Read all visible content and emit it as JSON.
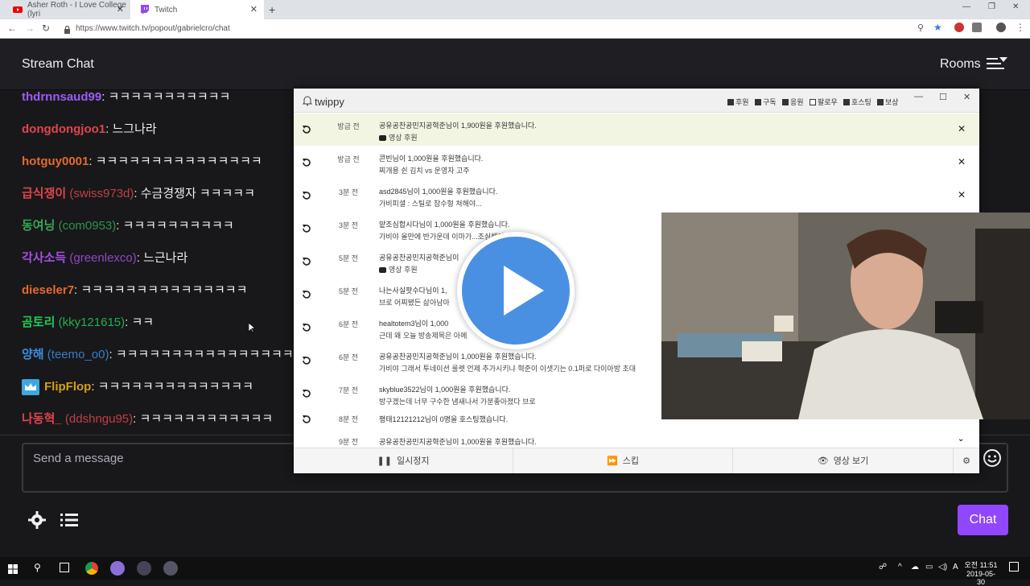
{
  "browser": {
    "tabs": [
      {
        "title": "Asher Roth - I Love College (lyri"
      },
      {
        "title": "Twitch"
      }
    ],
    "url": "https://www.twitch.tv/popout/gabrielcro/chat"
  },
  "header": {
    "title": "Stream Chat",
    "rooms_label": "Rooms"
  },
  "messages": [
    {
      "user": "thdrnnsaud99",
      "login": "",
      "text": ": ㅋㅋㅋㅋㅋㅋㅋㅋㅋㅋㅋ",
      "color": "#9c5bf6"
    },
    {
      "user": "dongdongjoo1",
      "login": "",
      "text": ": 느그나라",
      "color": "#e0454d"
    },
    {
      "user": "hotguy0001",
      "login": "",
      "text": ": ㅋㅋㅋㅋㅋㅋㅋㅋㅋㅋㅋㅋㅋㅋㅋ",
      "color": "#e46a2e"
    },
    {
      "user": "급식쟁이",
      "login": " (swiss973d)",
      "text": ": 수금경쟁자 ㅋㅋㅋㅋㅋ",
      "color": "#e0454d"
    },
    {
      "user": "동여닝",
      "login": " (com0953)",
      "text": ": ㅋㅋㅋㅋㅋㅋㅋㅋㅋㅋ",
      "color": "#34a853"
    },
    {
      "user": "각사소득",
      "login": " (greenlexco)",
      "text": ": 느근나라",
      "color": "#a650e0"
    },
    {
      "user": "dieseler7",
      "login": "",
      "text": ": ㅋㅋㅋㅋㅋㅋㅋㅋㅋㅋㅋㅋㅋㅋㅋ",
      "color": "#e46a2e"
    },
    {
      "user": "곰토리",
      "login": " (kky121615)",
      "text": ": ㅋㅋ",
      "color": "#1fca56"
    },
    {
      "user": "양해",
      "login": " (teemo_o0)",
      "text": ": ㅋㅋㅋㅋㅋㅋㅋㅋㅋㅋㅋㅋㅋㅋㅋㅋ",
      "color": "#3b8fe0"
    },
    {
      "user": "FlipFlop",
      "login": "",
      "text": ": ㅋㅋㅋㅋㅋㅋㅋㅋㅋㅋㅋㅋㅋㅋ",
      "color": "#d4a011"
    },
    {
      "user": "나동혁_",
      "login": " (ddshngu95)",
      "text": ": ㅋㅋㅋㅋㅋㅋㅋㅋㅋㅋㅋㅋ",
      "color": "#e0454d"
    }
  ],
  "input": {
    "placeholder": "Send a message"
  },
  "chat_button_label": "Chat",
  "twippy": {
    "title": "twippy",
    "filters": [
      {
        "label": "후원",
        "checked": true
      },
      {
        "label": "구독",
        "checked": true
      },
      {
        "label": "응원",
        "checked": true
      },
      {
        "label": "팔로우",
        "checked": false
      },
      {
        "label": "호스팅",
        "checked": true
      },
      {
        "label": "보상",
        "checked": true
      }
    ],
    "rows": [
      {
        "time": "방금 전",
        "line1": "공유공찬공민지공혁준님이 1,900원을 후원했습니다.",
        "line2": "영상 후원",
        "yt": true
      },
      {
        "time": "방금 전",
        "line1": "콘빈님이 1,000원을 후원했습니다.",
        "line2": "찌개용 쉰 김치 vs 운영자 고주",
        "yt": false
      },
      {
        "time": "3분 전",
        "line1": "asd2845님이 1,000원을 후원했습니다.",
        "line2": "가비피셜 : 스틸로 참수형 쳐해야...",
        "yt": false
      },
      {
        "time": "3분 전",
        "line1": "맡조심합시다님이 1,000원을 후원했습니다.",
        "line2": "가비야 올만에 반가운데 이마가...조심해야 돼",
        "yt": false
      },
      {
        "time": "5분 전",
        "line1": "공유공찬공민지공혁준님이",
        "line2": "영상 후원",
        "yt": true
      },
      {
        "time": "5분 전",
        "line1": "나는사실팟수다님이 1,",
        "line2": "브로 어찌됐든 삶아남아",
        "yt": false
      },
      {
        "time": "6분 전",
        "line1": "healtotem3님이 1,000",
        "line2": "근데 왜 오늘 방송제목은 아메",
        "yt": false
      },
      {
        "time": "6분 전",
        "line1": "공유공찬공민지공혁준님이 1,000원을 후원했습니다.",
        "line2": "가비야 그래서 투네이션 룰렛 언제 추가시키냐 혁준이 이샛기는 0.1퍼로 다이아방 초대",
        "yt": false
      },
      {
        "time": "7분 전",
        "line1": "skyblue3522님이 1,000원을 후원했습니다.",
        "line2": "방구겠는데 너무 구수한 냄새나서 가분좋아졌다 브로",
        "yt": false
      },
      {
        "time": "8분 전",
        "line1": "평태12121212님이 0명을 호스팅했습니다.",
        "line2": "",
        "yt": false
      },
      {
        "time": "9분 전",
        "line1": "공유공찬공민지공혁준님이 1,000원을 후원했습니다.",
        "line2": "",
        "yt": false
      }
    ],
    "footer": {
      "pause": "일시정지",
      "skip": "스킵",
      "view": "영상 보기"
    }
  },
  "taskbar": {
    "time": "오전 11:51",
    "date": "2019-05-30"
  }
}
